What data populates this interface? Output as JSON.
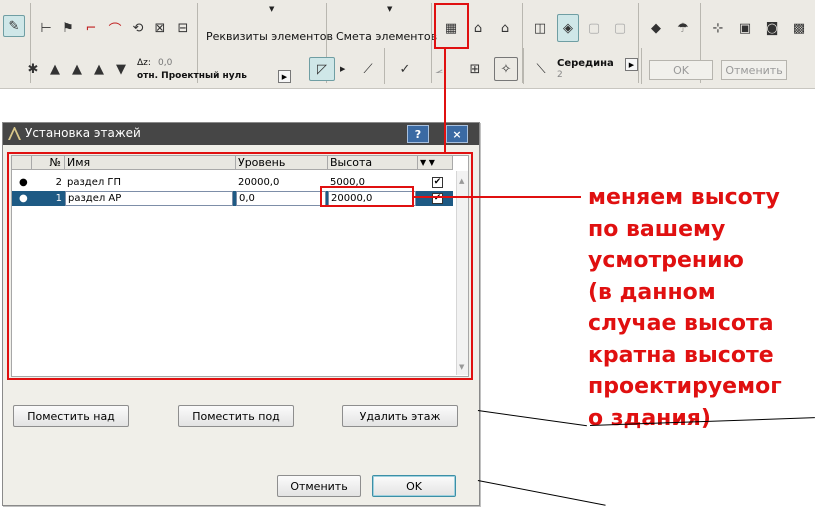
{
  "toolbar": {
    "attributes_label": "Реквизиты элементов",
    "estimate_label": "Смета элементов",
    "dz_label": "Δz:",
    "dz_value": "0,0",
    "reference_label": "отн. Проектный нуль",
    "snap_label": "Середина",
    "snap_value": "2",
    "ok_label": "OK",
    "cancel_label": "Отменить"
  },
  "dialog": {
    "title": "Установка этажей",
    "help_button": "?",
    "close_button": "×",
    "columns": [
      "№",
      "Имя",
      "Уровень",
      "Высота"
    ],
    "rows": [
      {
        "num": "2",
        "name": "раздел ГП",
        "level": "20000,0",
        "height": "5000,0",
        "show": "✔"
      },
      {
        "num": "1",
        "name": "раздел АР",
        "level": "0,0",
        "height": "20000,0",
        "show": "✔"
      }
    ],
    "insert_above_label": "Поместить над",
    "insert_below_label": "Поместить под",
    "delete_label": "Удалить этаж",
    "cancel_label": "Отменить",
    "ok_label": "OK"
  },
  "annotation": {
    "lines": [
      "меняем высоту",
      "по вашему",
      "усмотрению",
      "(в данном",
      "случае высота",
      "кратна высоте",
      "проектируемог",
      "о здания)"
    ]
  },
  "colors": {
    "annotation_red": "#e01010",
    "selected_row": "#1e5a84",
    "titlebar": "#464646"
  }
}
